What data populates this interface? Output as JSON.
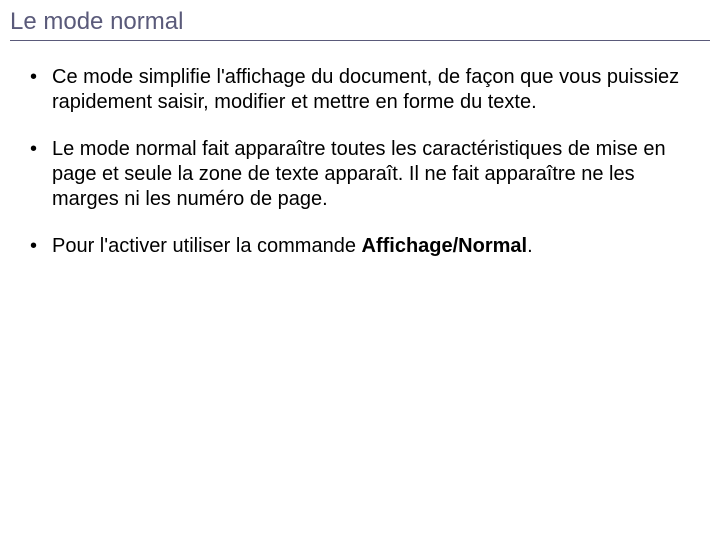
{
  "title": "Le mode normal",
  "bullets": [
    {
      "text": "Ce mode simplifie l'affichage du document, de façon que vous puissiez rapidement saisir, modifier et mettre en forme du texte."
    },
    {
      "text": "Le mode normal fait apparaître toutes les caractéristiques de mise en page et seule la zone de texte apparaît. Il ne fait apparaître ne les marges ni les numéro de page."
    },
    {
      "text_prefix": "Pour l'activer utiliser la commande ",
      "bold": "Affichage/Normal",
      "text_suffix": "."
    }
  ]
}
